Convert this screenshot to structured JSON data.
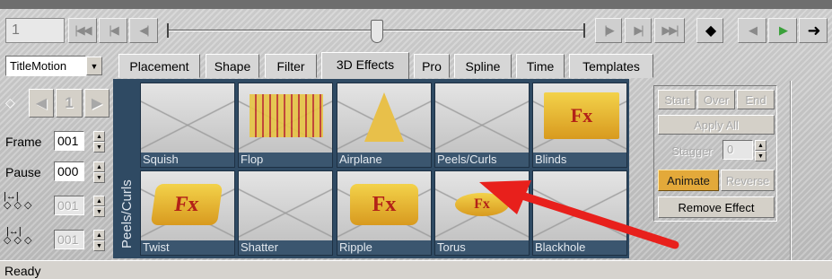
{
  "transport": {
    "frame_value": "1",
    "buttons": [
      "go-to-start",
      "step-back",
      "rewind",
      "play",
      "step-forward",
      "go-to-end"
    ],
    "keyframe_symbol": "◆",
    "nav_arrows": [
      "◀",
      "▶",
      "➜"
    ]
  },
  "title_combo": {
    "value": "TitleMotion"
  },
  "tabs": [
    "Placement",
    "Shape",
    "Filter",
    "3D Effects",
    "Pro",
    "Spline",
    "Time",
    "Templates"
  ],
  "active_tab": "3D Effects",
  "left_panel": {
    "key_index": "1",
    "frame_label": "Frame",
    "frame_value": "001",
    "pause_label": "Pause",
    "pause_value": "000",
    "ease_in_value": "001",
    "ease_out_value": "001"
  },
  "category_label": "Peels/Curls",
  "effects": [
    {
      "name": "Squish",
      "art": ""
    },
    {
      "name": "Flop",
      "art": "grid"
    },
    {
      "name": "Airplane",
      "art": "airplane"
    },
    {
      "name": "Peels/Curls",
      "art": ""
    },
    {
      "name": "Blinds",
      "art": "Fx"
    },
    {
      "name": "Twist",
      "art": "Fx"
    },
    {
      "name": "Shatter",
      "art": ""
    },
    {
      "name": "Ripple",
      "art": "Fx"
    },
    {
      "name": "Torus",
      "art": "Fx"
    },
    {
      "name": "Blackhole",
      "art": ""
    }
  ],
  "options": {
    "start": "Start",
    "over": "Over",
    "end": "End",
    "apply_all": "Apply All",
    "stagger_label": "Stagger",
    "stagger_value": "0",
    "animate": "Animate",
    "reverse": "Reverse",
    "remove_effect": "Remove Effect"
  },
  "status": "Ready",
  "colors": {
    "accent_animate": "#e3a93a",
    "grid_bg": "#2f4a63",
    "arrow": "#e8201c",
    "play_green": "#3aa03a"
  }
}
